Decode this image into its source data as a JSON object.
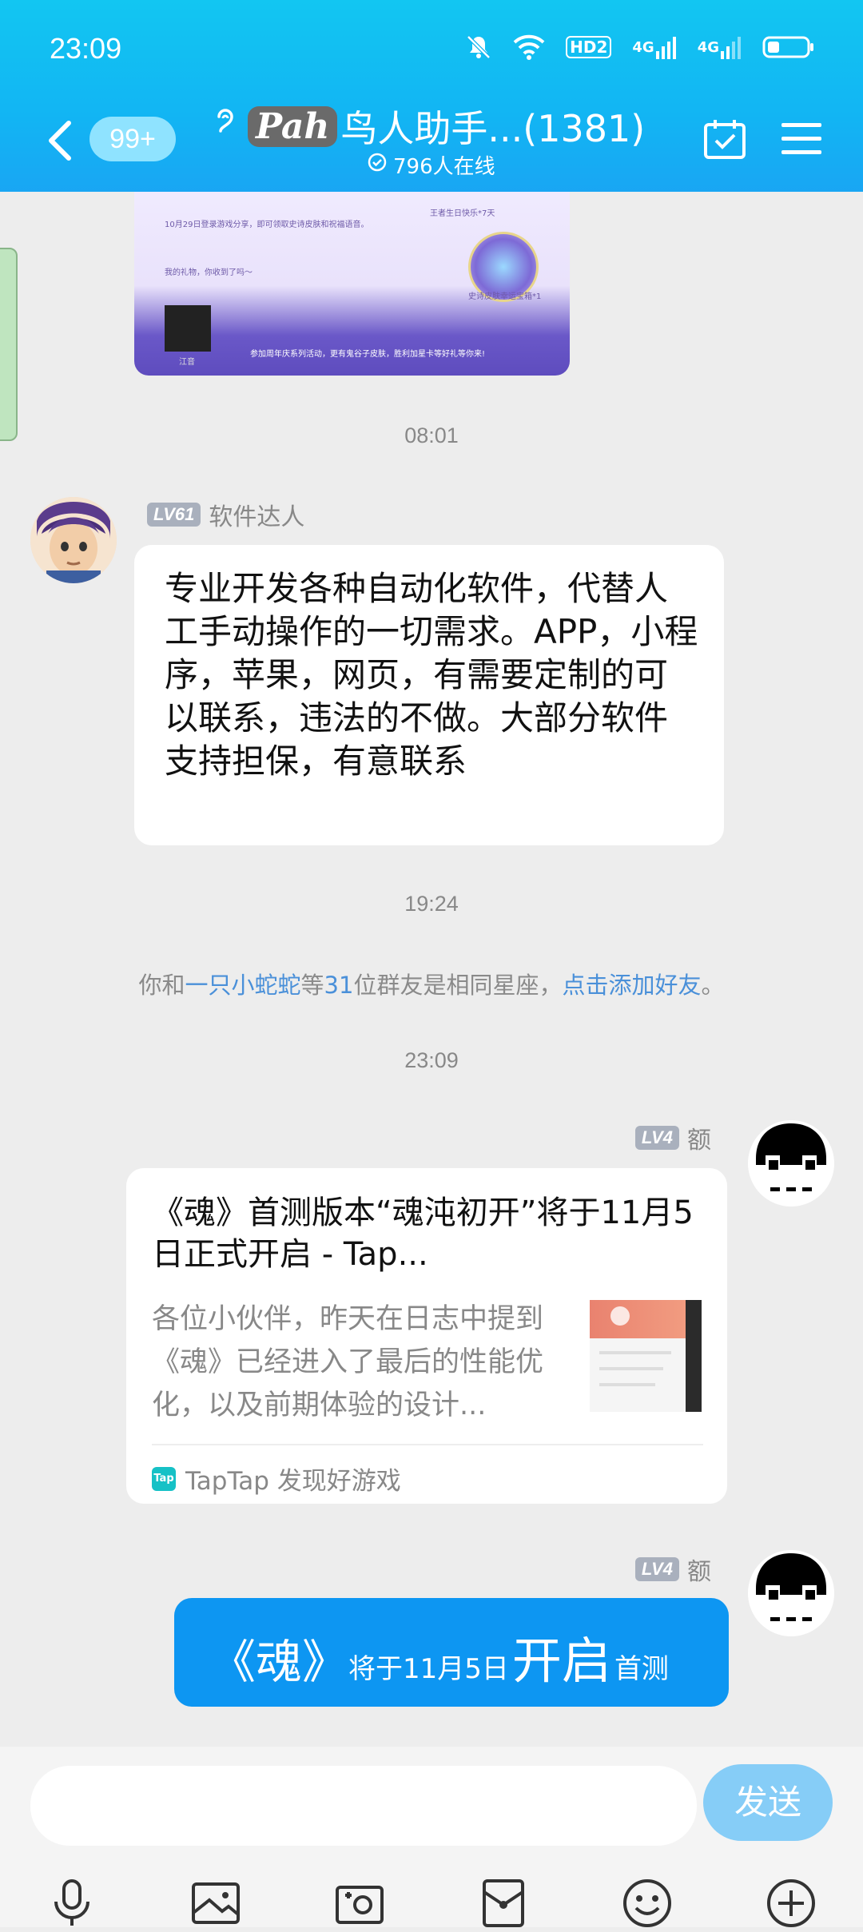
{
  "status_bar": {
    "time": "23:09",
    "hd_label": "HD2",
    "net1": "4G",
    "net2": "4G"
  },
  "header": {
    "unread_badge": "99+",
    "group_logo": "Pah",
    "group_title": "鸟人助手...(1381)",
    "online_count": "796人在线"
  },
  "shared_image_text": {
    "line1": "10月29日登录游戏分享，即可领取史诗皮肤和祝福语音。",
    "line2": "我的礼物，你收到了吗～",
    "label1": "王者生日快乐*7天",
    "label2": "史诗皮肤幸运宝箱*1",
    "footer": "参加周年庆系列活动，更有鬼谷子皮肤，胜利加星卡等好礼等你来!",
    "photo_caption": "江音"
  },
  "messages": {
    "time1": "08:01",
    "m1_level": "LV61",
    "m1_sender": "软件达人",
    "m1_text": "专业开发各种自动化软件，代替人工手动操作的一切需求。APP，小程序，苹果，网页，有需要定制的可以联系，违法的不做。大部分软件支持担保，有意联系",
    "time2": "19:24",
    "sys_prefix": "你和",
    "sys_link_user": "一只小蛇蛇",
    "sys_mid1": "等",
    "sys_count": "31",
    "sys_mid2": "位群友是相同星座，",
    "sys_link_action": "点击添加好友",
    "sys_end": "。",
    "time3": "23:09",
    "m2_level": "LV4",
    "m2_sender": "额",
    "m2_card_title": "《魂》首测版本“魂沌初开”将于11月5日正式开启 - Tap...",
    "m2_card_desc": "各位小伙伴，昨天在日志中提到《魂》已经进入了最后的性能优化，以及前期体验的设计...",
    "m2_card_source": "TapTap 发现好游戏",
    "m2_card_source_logo": "Tap",
    "m3_level": "LV4",
    "m3_sender": "额",
    "m3_part1": "《魂》",
    "m3_part2": "将于11月5日",
    "m3_part3": "开启",
    "m3_part4": "首测"
  },
  "input": {
    "placeholder": "",
    "send_label": "发送"
  },
  "toolbar_icons": [
    "microphone-icon",
    "image-icon",
    "camera-icon",
    "red-packet-icon",
    "emoji-icon",
    "plus-icon"
  ],
  "colors": {
    "header": "#12b5f3",
    "link": "#4a90d9",
    "self_bubble": "#0d96f2",
    "send_button": "#86cdf7"
  }
}
